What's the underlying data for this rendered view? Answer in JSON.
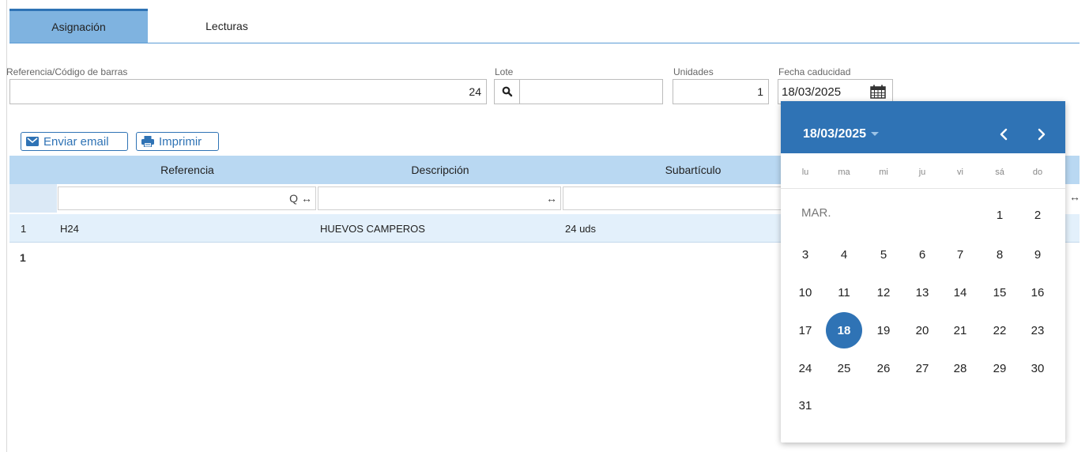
{
  "tabs": [
    {
      "label": "Asignación",
      "active": true
    },
    {
      "label": "Lecturas",
      "active": false
    }
  ],
  "form": {
    "referencia": {
      "label": "Referencia/Código de barras",
      "value": "24"
    },
    "lote": {
      "label": "Lote",
      "value": ""
    },
    "unidades": {
      "label": "Unidades",
      "value": "1"
    },
    "fecha": {
      "label": "Fecha caducidad",
      "value": "18/03/2025"
    }
  },
  "buttons": {
    "email": "Enviar email",
    "print": "Imprimir"
  },
  "table": {
    "columns": [
      "Referencia",
      "Descripción",
      "Subartículo"
    ],
    "filter_symbols": {
      "search": "Q",
      "resize": "↔"
    },
    "rows": [
      {
        "index": "1",
        "referencia": "H24",
        "descripcion": "HUEVOS CAMPEROS",
        "subarticulo": "24 uds"
      }
    ],
    "count": "1"
  },
  "calendar": {
    "title": "18/03/2025",
    "weekdays": [
      "lu",
      "ma",
      "mi",
      "ju",
      "vi",
      "sá",
      "do"
    ],
    "month_label": "MAR.",
    "first_weekday_index": 5,
    "days_in_month": 31,
    "selected_day": 18
  },
  "colors": {
    "accent": "#2f73b5",
    "tab_active": "#7fb3e0",
    "header_bg": "#b9d8f2",
    "row_bg": "#e3f0fb"
  }
}
